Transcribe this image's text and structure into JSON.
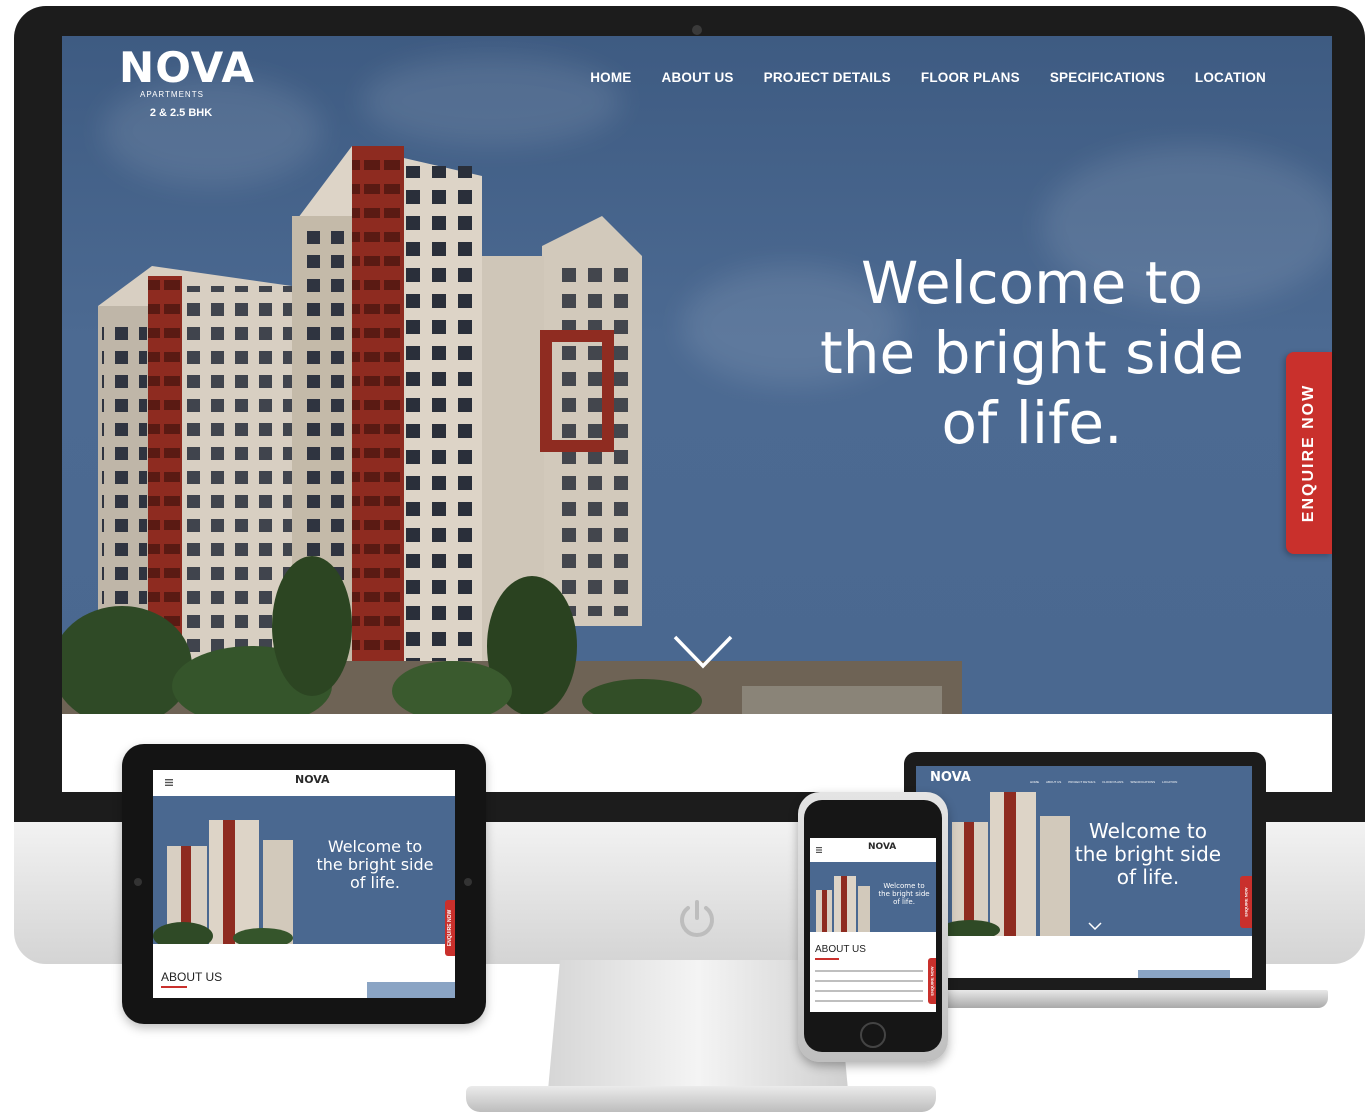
{
  "site": {
    "logo": "NOVA",
    "logo_sub": "APARTMENTS",
    "tagline": "2 & 2.5 BHK",
    "headline_1": "Welcome to",
    "headline_2": "the bright side",
    "headline_3": "of life.",
    "enquire": "ENQUIRE NOW",
    "about_heading": "ABOUT US"
  },
  "nav": {
    "items": [
      "HOME",
      "ABOUT US",
      "PROJECT DETAILS",
      "FLOOR PLANS",
      "SPECIFICATIONS",
      "LOCATION"
    ]
  },
  "icons": {
    "menu": "hamburger-menu-icon",
    "chevron": "chevron-down-icon",
    "power": "power-icon"
  },
  "colors": {
    "accent": "#c9302c",
    "sky": "#4a6890",
    "bezel": "#1c1c1c"
  }
}
